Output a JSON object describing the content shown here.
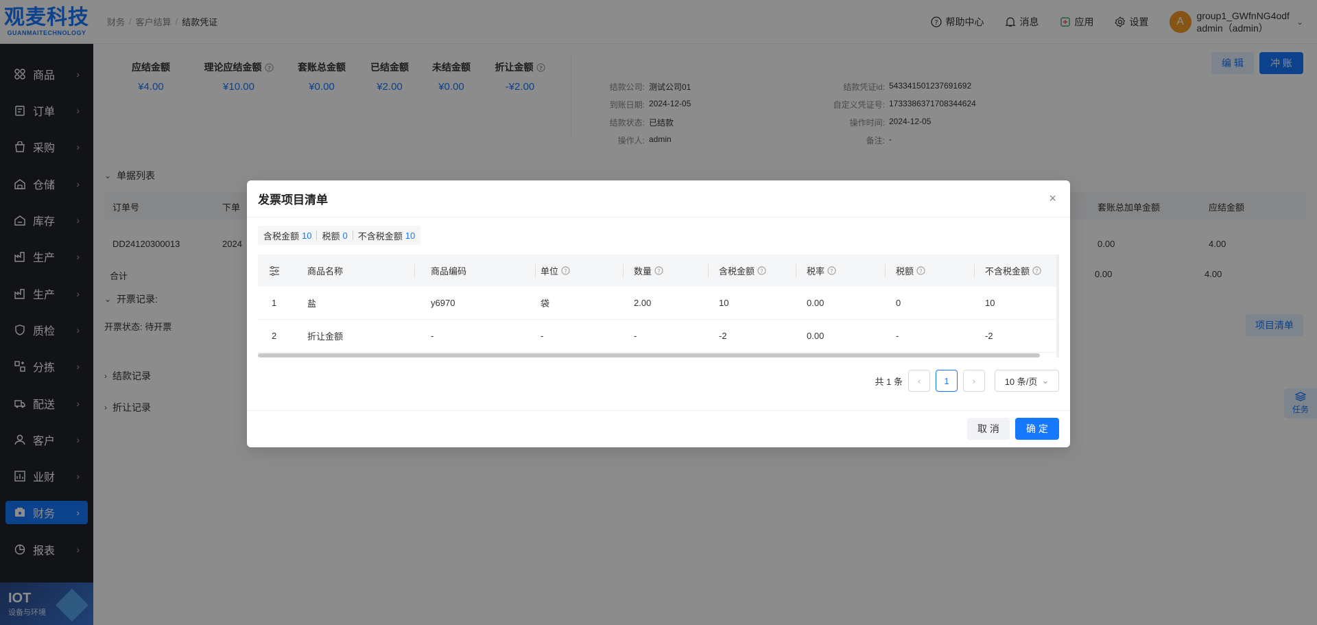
{
  "logo": {
    "main": "观麦科技",
    "sub": "GUANMAITECHNOLOGY"
  },
  "sidebar": {
    "items": [
      {
        "label": "商品",
        "icon": "goods-icon"
      },
      {
        "label": "订单",
        "icon": "order-icon"
      },
      {
        "label": "采购",
        "icon": "purchase-icon"
      },
      {
        "label": "仓储",
        "icon": "warehouse-icon"
      },
      {
        "label": "库存",
        "icon": "inventory-icon"
      },
      {
        "label": "生产",
        "icon": "production-icon"
      },
      {
        "label": "生产",
        "icon": "production-icon"
      },
      {
        "label": "质检",
        "icon": "quality-icon"
      },
      {
        "label": "分拣",
        "icon": "sorting-icon"
      },
      {
        "label": "配送",
        "icon": "delivery-icon"
      },
      {
        "label": "客户",
        "icon": "customer-icon"
      },
      {
        "label": "业财",
        "icon": "business-finance-icon"
      },
      {
        "label": "财务",
        "icon": "finance-icon",
        "active": true
      },
      {
        "label": "报表",
        "icon": "report-icon"
      }
    ],
    "iot": {
      "title": "IOT",
      "sub": "设备与环境"
    }
  },
  "header": {
    "breadcrumb": [
      "财务",
      "客户结算",
      "结款凭证"
    ],
    "help": "帮助中心",
    "messages": "消息",
    "apps": "应用",
    "settings": "设置",
    "user": {
      "avatar": "A",
      "name": "group1_GWfnNG4odf",
      "role": "admin（admin）"
    }
  },
  "summary": {
    "blocks": [
      {
        "label": "应结金额",
        "value": "¥4.00"
      },
      {
        "label": "理论应结金额",
        "value": "¥10.00",
        "help": true
      },
      {
        "label": "套账总金额",
        "value": "¥0.00"
      },
      {
        "label": "已结金额",
        "value": "¥2.00"
      },
      {
        "label": "未结金额",
        "value": "¥0.00"
      },
      {
        "label": "折让金额",
        "value": "-¥2.00",
        "help": true
      }
    ],
    "info_left": [
      {
        "label": "结款公司:",
        "value": "测试公司01"
      },
      {
        "label": "到账日期:",
        "value": "2024-12-05"
      },
      {
        "label": "结款状态:",
        "value": "已结款"
      },
      {
        "label": "操作人:",
        "value": "admin"
      }
    ],
    "info_right": [
      {
        "label": "结款凭证id:",
        "value": "543341501237691692"
      },
      {
        "label": "自定义凭证号:",
        "value": "1733386371708344624"
      },
      {
        "label": "操作时间:",
        "value": "2024-12-05"
      },
      {
        "label": "备注:",
        "value": "-"
      }
    ],
    "edit_label": "编 辑",
    "reverse_label": "冲 账"
  },
  "content": {
    "doc_list_title": "单据列表",
    "columns_left": [
      "订单号",
      "下单"
    ],
    "columns_right": [
      "套账总加单金额",
      "应结金额"
    ],
    "row1": {
      "order_no": "DD24120300013",
      "date_partial": "2024",
      "mix_total": "0.00",
      "due": "4.00"
    },
    "total_row": {
      "label": "合计",
      "mix_total": "0.00",
      "due": "4.00"
    },
    "invoice_title": "开票记录:",
    "invoice_status": "开票状态: 待开票",
    "item_list_btn": "项目清单",
    "payment_title": "结款记录",
    "discount_title": "折让记录",
    "task_label": "任务"
  },
  "modal": {
    "title": "发票项目清单",
    "totals": [
      {
        "label": "含税金额",
        "value": "10"
      },
      {
        "label": "税额",
        "value": "0"
      },
      {
        "label": "不含税金额",
        "value": "10"
      }
    ],
    "columns": [
      {
        "label": "商品名称",
        "help": false
      },
      {
        "label": "商品编码",
        "help": false
      },
      {
        "label": "单位",
        "help": true
      },
      {
        "label": "数量",
        "help": true
      },
      {
        "label": "含税金额",
        "help": true
      },
      {
        "label": "税率",
        "help": true
      },
      {
        "label": "税额",
        "help": true
      },
      {
        "label": "不含税金额",
        "help": true
      }
    ],
    "rows": [
      {
        "idx": "1",
        "name": "盐",
        "code": "y6970",
        "unit": "袋",
        "qty": "2.00",
        "amount_tax": "10",
        "rate": "0.00",
        "tax": "0",
        "amount_no_tax": "10"
      },
      {
        "idx": "2",
        "name": "折让金额",
        "code": "-",
        "unit": "-",
        "qty": "-",
        "amount_tax": "-2",
        "rate": "0.00",
        "tax": "-",
        "amount_no_tax": "-2"
      }
    ],
    "pager": {
      "total": "共 1 条",
      "page": "1",
      "size": "10 条/页"
    },
    "cancel_label": "取 消",
    "ok_label": "确 定"
  }
}
